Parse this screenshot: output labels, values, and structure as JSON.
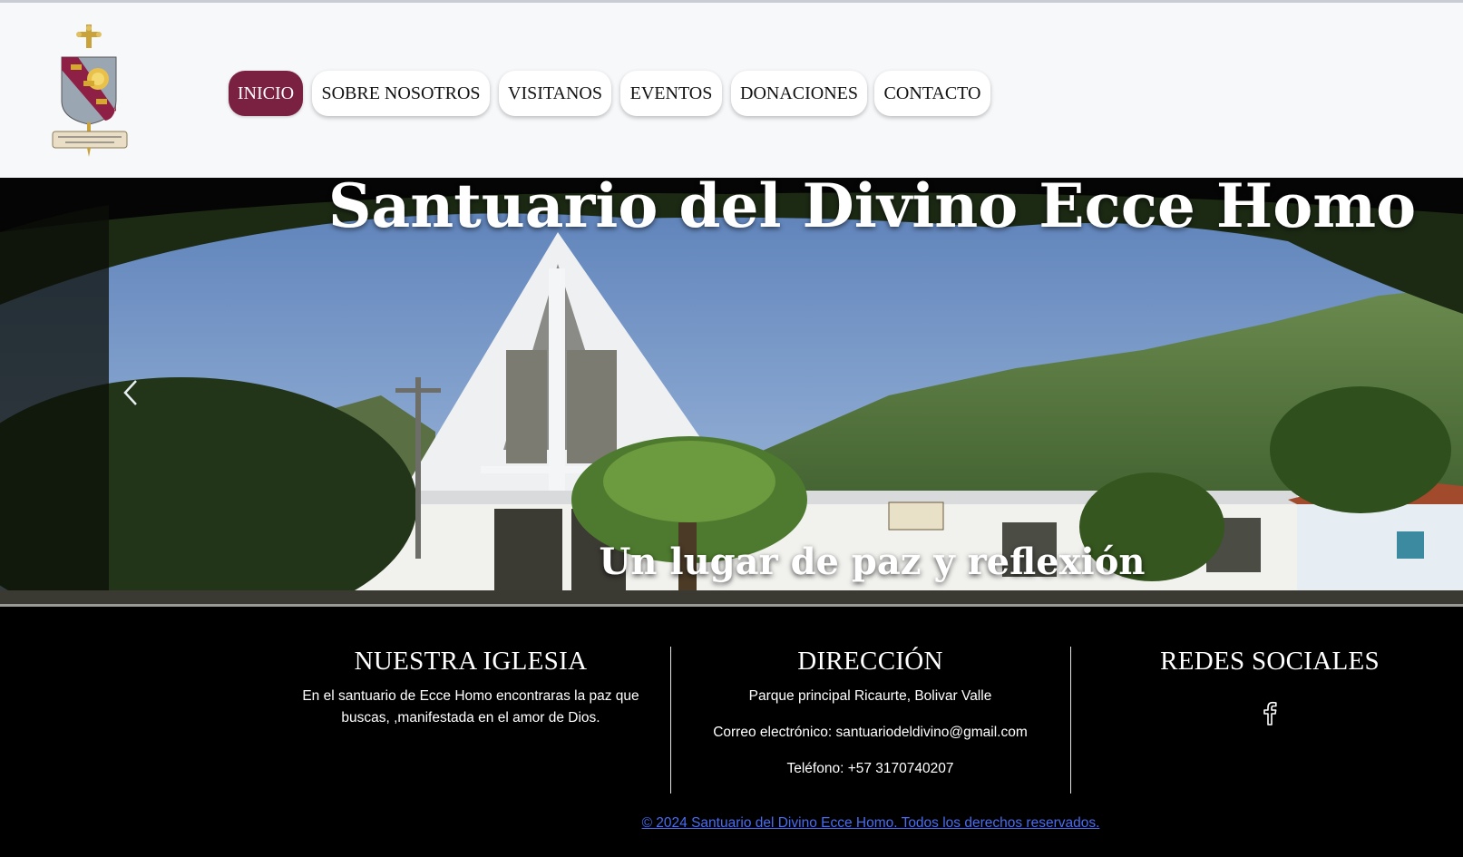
{
  "header": {
    "logo_icon": "diocese-coat-of-arms",
    "nav": [
      {
        "label": "INICIO",
        "active": true
      },
      {
        "label": "SOBRE NOSOTROS",
        "active": false
      },
      {
        "label": "VISITANOS",
        "active": false
      },
      {
        "label": "EVENTOS",
        "active": false
      },
      {
        "label": "DONACIONES",
        "active": false
      },
      {
        "label": "CONTACTO",
        "active": false
      }
    ],
    "accent_color": "#7a2040"
  },
  "hero": {
    "title": "Santuario del Divino Ecce Homo",
    "subtitle": "Un lugar de paz y reflexión",
    "prev_icon": "chevron-left-icon"
  },
  "footer": {
    "church": {
      "heading": "NUESTRA IGLESIA",
      "text": "En el santuario de Ecce Homo encontraras la paz que buscas, ,manifestada en el amor de Dios."
    },
    "address": {
      "heading": "DIRECCIÓN",
      "line1": "Parque principal Ricaurte, Bolivar Valle",
      "email": "Correo electrónico: santuariodeldivino@gmail.com",
      "phone": "Teléfono: +57 3170740207"
    },
    "social": {
      "heading": "REDES SOCIALES",
      "icon": "facebook-icon"
    },
    "copyright": "© 2024 Santuario del Divino Ecce Homo. Todos los derechos reservados."
  }
}
